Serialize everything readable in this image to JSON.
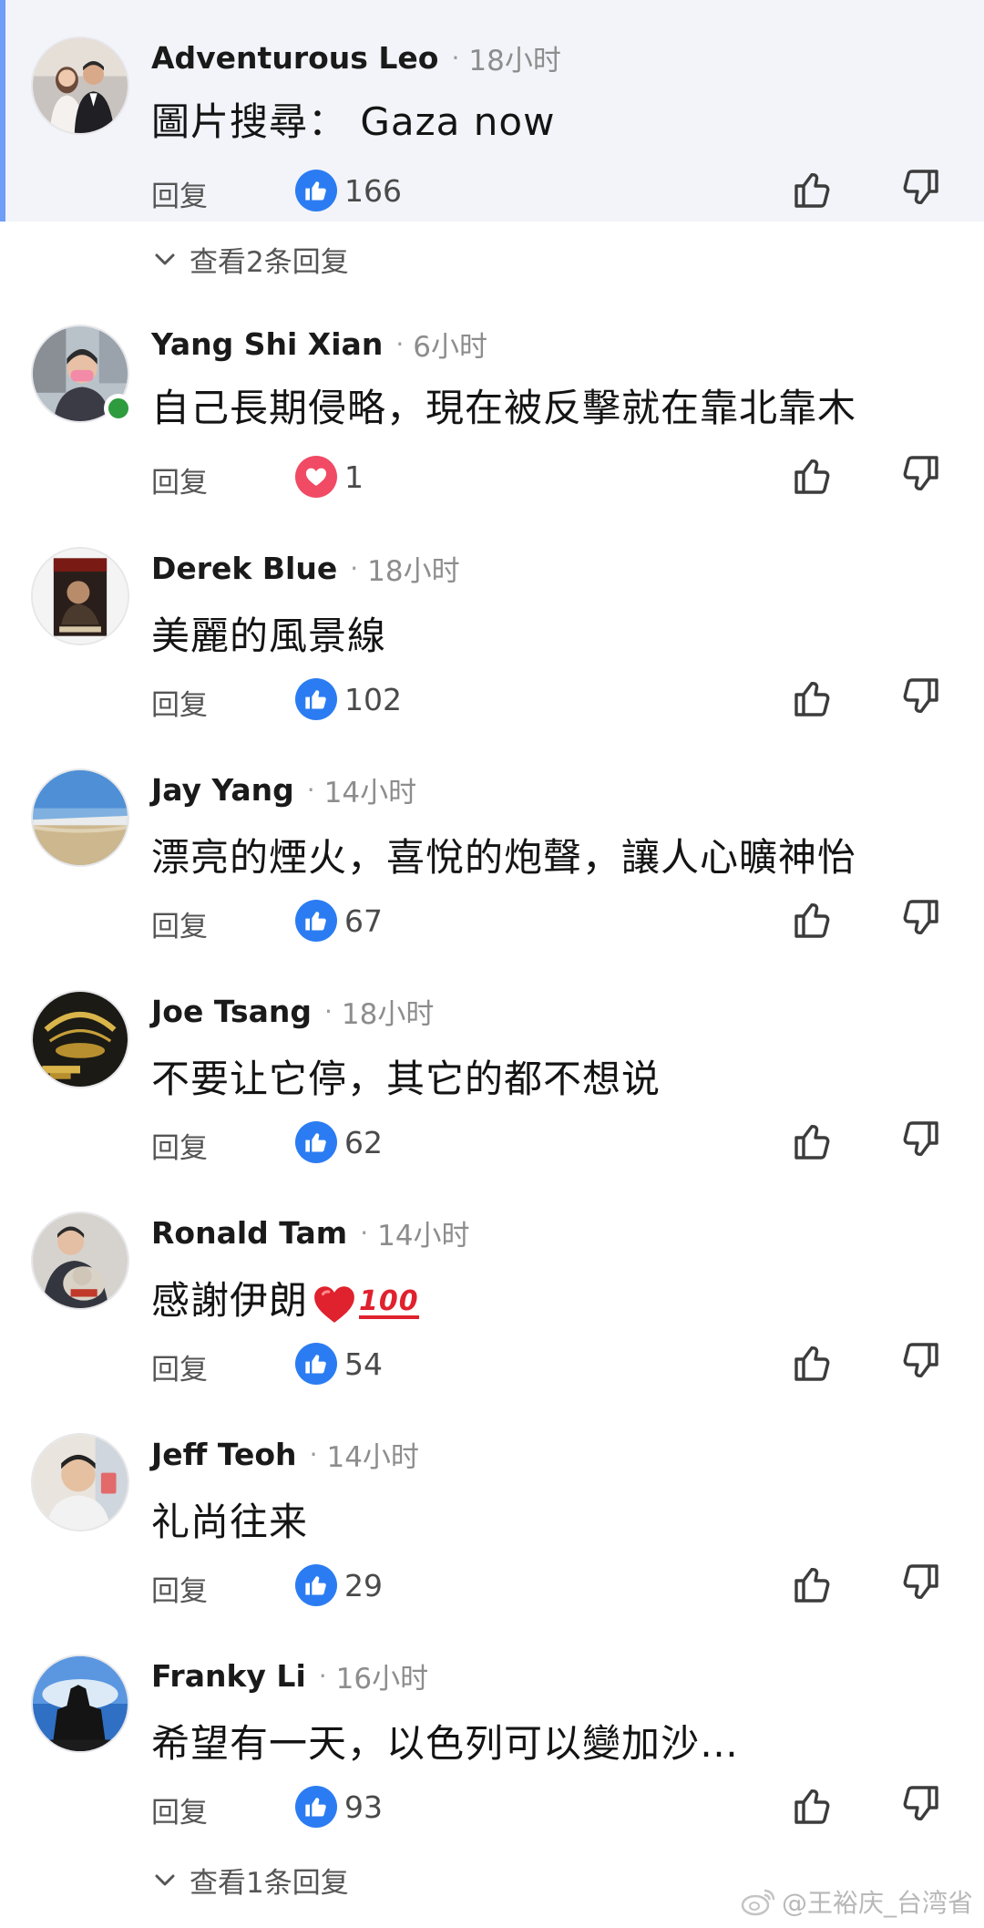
{
  "comments": [
    {
      "name": "Adventurous Leo",
      "time": "18小时",
      "text": "圖片搜尋：  Gaza now",
      "reply": "回复",
      "reaction": "like",
      "count": "166",
      "highlighted": true
    },
    {
      "name": "Yang Shi Xian",
      "time": "6小时",
      "text": "自己長期侵略，現在被反擊就在靠北靠木",
      "reply": "回复",
      "reaction": "love",
      "count": "1",
      "online": true
    },
    {
      "name": "Derek Blue",
      "time": "18小时",
      "text": "美麗的風景線",
      "reply": "回复",
      "reaction": "like",
      "count": "102"
    },
    {
      "name": "Jay Yang",
      "time": "14小时",
      "text": "漂亮的煙火，喜悅的炮聲，讓人心曠神怡",
      "reply": "回复",
      "reaction": "like",
      "count": "67"
    },
    {
      "name": "Joe Tsang",
      "time": "18小时",
      "text": "不要让它停，其它的都不想说",
      "reply": "回复",
      "reaction": "like",
      "count": "62"
    },
    {
      "name": "Ronald Tam",
      "time": "14小时",
      "text": "感謝伊朗",
      "emoji_100": "100",
      "reply": "回复",
      "reaction": "like",
      "count": "54"
    },
    {
      "name": "Jeff Teoh",
      "time": "14小时",
      "text": "礼尚往来",
      "reply": "回复",
      "reaction": "like",
      "count": "29"
    },
    {
      "name": "Franky Li",
      "time": "16小时",
      "text": "希望有一天，以色列可以變加沙…",
      "reply": "回复",
      "reaction": "like",
      "count": "93"
    }
  ],
  "view_replies_1": "查看2条回复",
  "view_replies_2": "查看1条回复",
  "watermark": "@王裕庆_台湾省",
  "colors": {
    "like": "#2b7cf2",
    "love": "#f04a64",
    "accent": "#6f9ef6",
    "highlight_bg": "#f3f4f9"
  },
  "icons": {
    "like": "thumbs-up-icon",
    "love": "heart-icon",
    "dislike": "thumbs-down-icon",
    "expand": "chevron-down-icon",
    "watermark": "weibo-icon"
  }
}
